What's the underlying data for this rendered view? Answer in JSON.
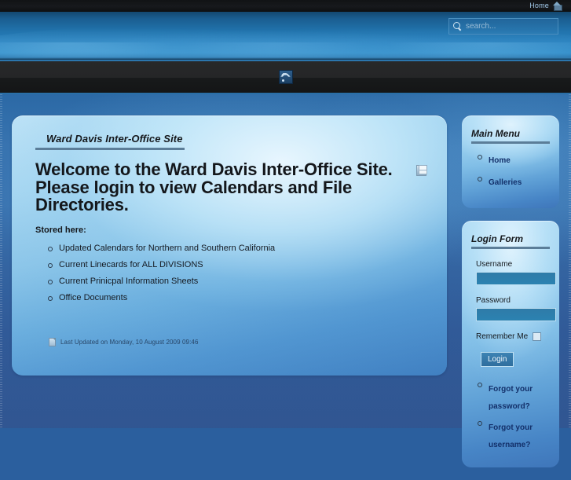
{
  "top_bar": {
    "home_link": "Home",
    "home_icon": "home-icon"
  },
  "header": {
    "search": {
      "placeholder": "search...",
      "value": "",
      "icon": "search-icon"
    }
  },
  "nav": {
    "rss_icon": "rss-feed-icon"
  },
  "content": {
    "article_title": "Ward Davis Inter-Office Site",
    "heading": "Welcome to the Ward Davis Inter-Office Site. Please login to view Calendars and File Directories.",
    "print_icon": "print-icon",
    "stored_label": "Stored here:",
    "stored_items": [
      "Updated Calendars for Northern and Southern California",
      "Current Linecards for ALL DIVISIONS",
      "Current Prinicpal Information Sheets",
      "Office Documents"
    ],
    "last_updated": "Last Updated on Monday, 10 August 2009 09:46",
    "last_updated_icon": "document-icon"
  },
  "sidebar": {
    "main_menu": {
      "title": "Main Menu",
      "items": [
        {
          "label": "Home"
        },
        {
          "label": "Galleries"
        }
      ]
    },
    "login_form": {
      "title": "Login Form",
      "username_label": "Username",
      "username_value": "",
      "password_label": "Password",
      "password_value": "",
      "remember_label": "Remember Me",
      "remember_checked": false,
      "login_button": "Login",
      "links": [
        {
          "label": "Forgot your password?"
        },
        {
          "label": "Forgot your username?"
        }
      ]
    }
  },
  "colors": {
    "header_blue": "#2a84c2",
    "nav_dark": "#242627",
    "panel_light": "#bfe4f7",
    "link_blue": "#13306a",
    "rule_gray": "#5b7d98"
  }
}
